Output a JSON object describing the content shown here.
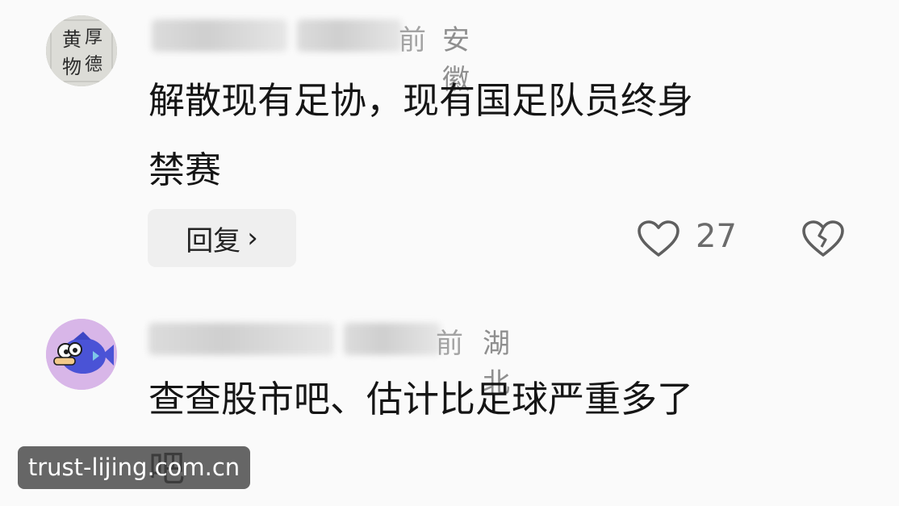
{
  "comments": [
    {
      "time_suffix": "前",
      "region": "安徽",
      "text_line1": "解散现有足协，现有国足队员终身",
      "text_line2": "禁赛",
      "reply_label": "回复",
      "reply_chevron": "›",
      "like_count": "27",
      "avatar_icon": "calligraphy-avatar"
    },
    {
      "time_suffix": "前",
      "region": "湖北",
      "text_line1": "查查股市吧、估计比足球严重多了",
      "text_line2": "吧",
      "avatar_icon": "cartoon-fish-avatar"
    }
  ],
  "icons": {
    "like": "heart-icon",
    "dislike": "broken-heart-icon"
  },
  "watermark": "trust-lijing.com.cn"
}
